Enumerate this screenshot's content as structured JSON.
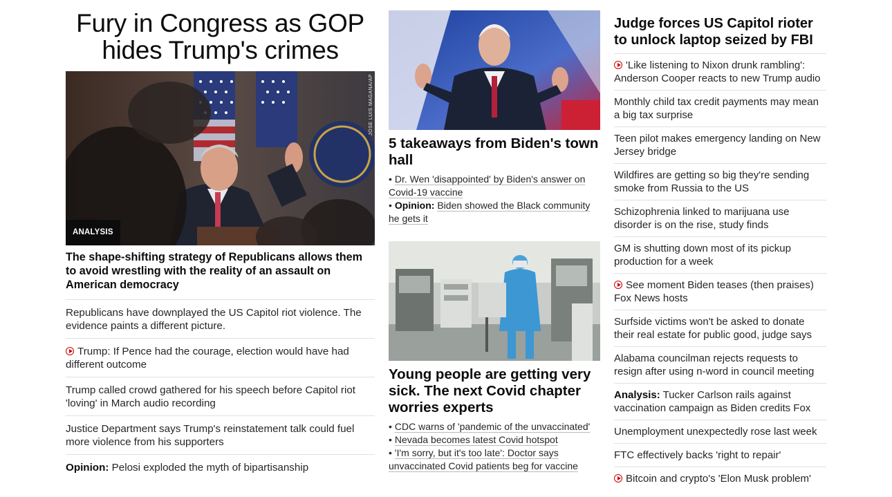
{
  "left": {
    "headline": "Fury in Congress as GOP hides Trump's crimes",
    "badge": "ANALYSIS",
    "photo_credit": "JOSE LUIS MAGANA/AP",
    "lead": "The shape-shifting strategy of Republicans allows them to avoid wrestling with the reality of an assault on American democracy",
    "items": [
      {
        "text": "Republicans have downplayed the US Capitol riot violence. The evidence paints a different picture.",
        "video": false,
        "prefix": ""
      },
      {
        "text": "Trump: If Pence had the courage, election would have had different outcome",
        "video": true,
        "prefix": ""
      },
      {
        "text": "Trump called crowd gathered for his speech before Capitol riot 'loving' in March audio recording",
        "video": false,
        "prefix": ""
      },
      {
        "text": "Justice Department says Trump's reinstatement talk could fuel more violence from his supporters",
        "video": false,
        "prefix": ""
      },
      {
        "text": "Pelosi exploded the myth of bipartisanship",
        "video": false,
        "prefix": "Opinion:"
      }
    ]
  },
  "middle": {
    "story1": {
      "title": "5 takeaways from Biden's town hall",
      "items": [
        {
          "prefix": "",
          "text": "Dr. Wen 'disappointed' by Biden's answer on Covid-19 vaccine"
        },
        {
          "prefix": "Opinion:",
          "text": "Biden showed the Black community he gets it"
        }
      ]
    },
    "story2": {
      "title": "Young people are getting very sick. The next Covid chapter worries experts",
      "items": [
        {
          "prefix": "",
          "text": "CDC warns of 'pandemic of the unvaccinated'"
        },
        {
          "prefix": "",
          "text": "Nevada becomes latest Covid hotspot"
        },
        {
          "prefix": "",
          "text": "'I'm sorry, but it's too late': Doctor says unvaccinated Covid patients beg for vaccine"
        }
      ]
    }
  },
  "right": {
    "title": "Judge forces US Capitol rioter to unlock laptop seized by FBI",
    "items": [
      {
        "text": "'Like listening to Nixon drunk rambling': Anderson Cooper reacts to new Trump audio",
        "video": true,
        "prefix": ""
      },
      {
        "text": "Monthly child tax credit payments may mean a big tax surprise",
        "video": false,
        "prefix": ""
      },
      {
        "text": "Teen pilot makes emergency landing on New Jersey bridge",
        "video": false,
        "prefix": ""
      },
      {
        "text": "Wildfires are getting so big they're sending smoke from Russia to the US",
        "video": false,
        "prefix": ""
      },
      {
        "text": "Schizophrenia linked to marijuana use disorder is on the rise, study finds",
        "video": false,
        "prefix": ""
      },
      {
        "text": "GM is shutting down most of its pickup production for a week",
        "video": false,
        "prefix": ""
      },
      {
        "text": "See moment Biden teases (then praises) Fox News hosts",
        "video": true,
        "prefix": ""
      },
      {
        "text": "Surfside victims won't be asked to donate their real estate for public good, judge says",
        "video": false,
        "prefix": ""
      },
      {
        "text": "Alabama councilman rejects requests to resign after using n-word in council meeting",
        "video": false,
        "prefix": ""
      },
      {
        "text": "Tucker Carlson rails against vaccination campaign as Biden credits Fox",
        "video": false,
        "prefix": "Analysis:"
      },
      {
        "text": "Unemployment unexpectedly rose last week",
        "video": false,
        "prefix": ""
      },
      {
        "text": "FTC effectively backs 'right to repair'",
        "video": false,
        "prefix": ""
      },
      {
        "text": "Bitcoin and crypto's 'Elon Musk problem'",
        "video": true,
        "prefix": ""
      }
    ]
  },
  "colors": {
    "accent_red": "#cc0000",
    "text": "#0c0c0c",
    "divider": "#e1e1e1"
  }
}
